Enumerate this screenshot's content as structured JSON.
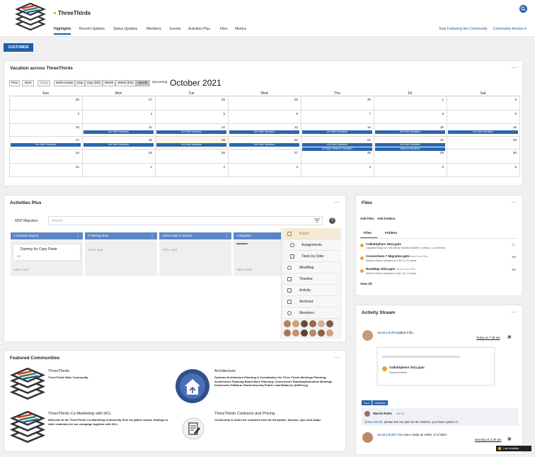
{
  "header": {
    "app_title": "ThreeThirds",
    "tabs": [
      "Highlights",
      "Recent Updates",
      "Status Updates",
      "Members",
      "Events",
      "Activities Plus",
      "Files",
      "Metrics"
    ],
    "stop_following": "Stop Following this Community",
    "community_actions": "Community Actions"
  },
  "customize_label": "CUSTOMIZE",
  "calendar": {
    "title": "Vacation across ThreeThirds",
    "month": "October 2021",
    "buttons": [
      "Prev",
      "Next",
      "Today",
      "Select Date",
      "Day",
      "Day (list)",
      "Week",
      "Week (list)",
      "Month",
      "Upcoming"
    ],
    "dow": [
      "Sun",
      "Mon",
      "Tue",
      "Wed",
      "Thu",
      "Fri",
      "Sat"
    ],
    "weeks": [
      [
        "26",
        "27",
        "28",
        "29",
        "30",
        "1",
        "2"
      ],
      [
        "3",
        "4",
        "5",
        "6",
        "7",
        "8",
        "9"
      ],
      [
        "10",
        "11",
        "12",
        "13",
        "14",
        "15",
        "16"
      ],
      [
        "17",
        "18",
        "19",
        "20",
        "21",
        "22",
        "23"
      ],
      [
        "24",
        "25",
        "26",
        "27",
        "28",
        "29",
        "30"
      ],
      [
        "31",
        "1",
        "2",
        "3",
        "4",
        "5",
        "6"
      ]
    ],
    "event_urs": "Urs Meli Vacation",
    "event_warren_timed": "12:00pm Warren Vacation",
    "event_warren": "Warren Vacation"
  },
  "activities": {
    "title": "Activities Plus",
    "board_name": "MSP Migration",
    "search_placeholder": "Search",
    "columns": [
      "1 Contract Signed",
      "2 Planing done",
      "Active Data in Started",
      "4 Migration"
    ],
    "card_title": "Dummy for Copy Paste",
    "card_meta": "0/0",
    "add_card": "Add a card",
    "menu": [
      "Board",
      "Assignments",
      "Tasks by Date",
      "MindMap",
      "Timeline",
      "Activity",
      "Archived",
      "Members"
    ]
  },
  "files": {
    "title": "Files",
    "add_files": "Add Files",
    "add_folders": "Add Folders",
    "tab_files": "Files",
    "tab_folders": "Folders",
    "items": [
      {
        "name": "CollabSphere 2021.pptx",
        "meta": "Updated today at 7:46 AM by Sandra Bühler | 4 views | 1 comment"
      },
      {
        "name": "Connections 7 Migration.pptx",
        "shared": "Shared from Files",
        "meta": "Warren Rams updated on Oct 3 | 33 views"
      },
      {
        "name": "RoadMap 2021.pptx",
        "shared": "Shared from Files",
        "meta": "Warren Rams updated on Apr 14 | 2 views"
      }
    ],
    "view_all": "View All"
  },
  "activity_stream": {
    "title": "Activity Stream",
    "post1_user": "Sandra Bühler",
    "post1_action": "added a file.",
    "post1_time": "Today at 7:46 am",
    "post1_file": "CollabSphere 2021.pptx",
    "post1_file_author": "Sandra Bühler",
    "save_label": "Save",
    "unfollow_label": "Unfollow",
    "comment_user": "Warren Rams",
    "comment_time": "Oct 11",
    "comment_mention": "@Jan Schultz",
    "comment_text": "please see our plan for the session, you have a part in it",
    "post2_user": "Sandra Bühler",
    "post2_action": "You were made an editor of a folder",
    "post2_time": "Monday at 2:35 pm",
    "chat_label": "I am Available"
  },
  "featured": {
    "title": "Featured Communities",
    "items": [
      {
        "name": "ThreeThirds",
        "desc": "ThreeThirds Main Community"
      },
      {
        "name": "Architecture",
        "desc": "Systems Architecture Planning & Coordination for Three Thirds  Meetings Planning: Architecture Planning Board  More Planning: Connections RoadmapSometime Meetings Kubernetes Platform Global Security Public Load Balancer (HAProxy)"
      },
      {
        "name": "ThreeThirds Co-Marketing with HCL",
        "desc": "Welcome to the ThreeThirds Co-Marketing Community Here we gather assets, findings or other materials for our campaign together with HCL."
      },
      {
        "name": "ThreeThirds Contracts and Pricing",
        "desc": "Community to share the contracts from all 3/3 parties, discuss, sync and adapt"
      }
    ]
  },
  "colors": {
    "accent": "#1f5fa8",
    "event": "#2a66ad",
    "kanban": "#5b86c5",
    "orange": "#f0a030"
  }
}
